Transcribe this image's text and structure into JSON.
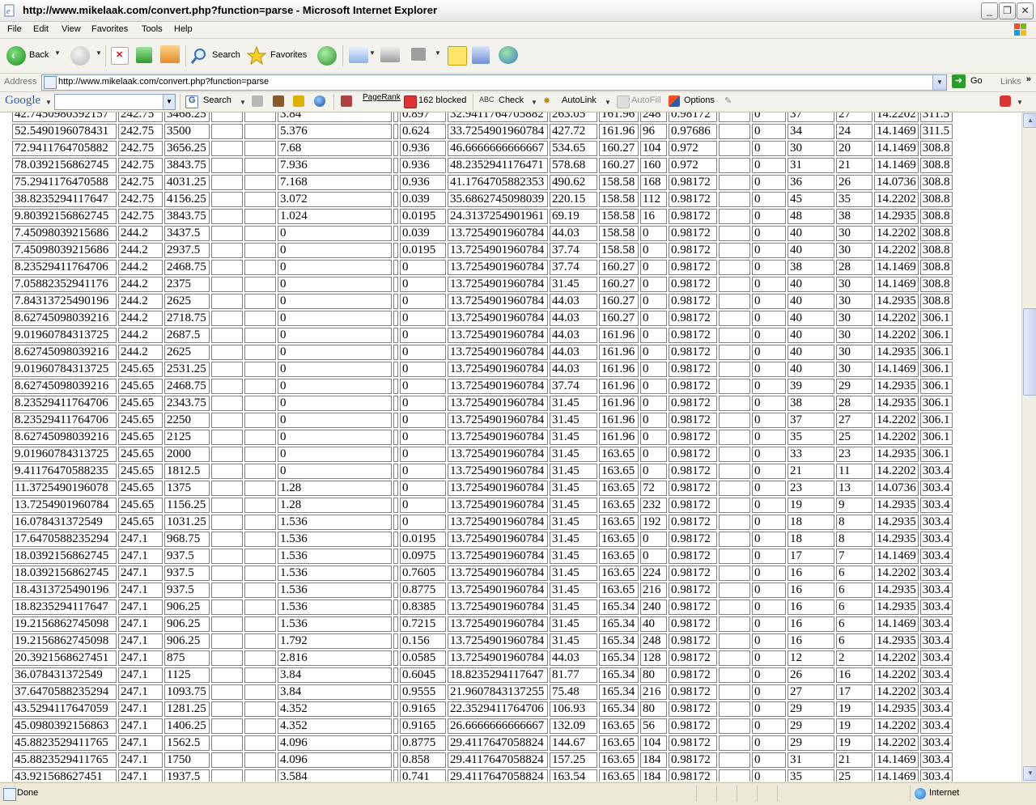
{
  "window": {
    "title": "http://www.mikelaak.com/convert.php?function=parse - Microsoft Internet Explorer"
  },
  "menu": [
    "File",
    "Edit",
    "View",
    "Favorites",
    "Tools",
    "Help"
  ],
  "toolbar": {
    "back": "Back",
    "search": "Search",
    "favorites": "Favorites"
  },
  "address": {
    "label": "Address",
    "url": "http://www.mikelaak.com/convert.php?function=parse",
    "go": "Go",
    "links": "Links"
  },
  "google": {
    "logo": "Google",
    "search": "Search",
    "pagerank": "PageRank",
    "blocked": "162 blocked",
    "check": "Check",
    "autolink": "AutoLink",
    "autofill": "AutoFill",
    "options": "Options"
  },
  "status": {
    "text": "Done",
    "zone": "Internet"
  },
  "table": {
    "rows": [
      [
        "42.7450980392157",
        "242.75",
        "3468.25",
        "",
        "",
        "3.84",
        "",
        "0.897",
        "32.9411764705882",
        "263.05",
        "161.96",
        "248",
        "0.98172",
        "",
        "0",
        "37",
        "27",
        "14.2202",
        "311.5"
      ],
      [
        "52.5490196078431",
        "242.75",
        "3500",
        "",
        "",
        "5.376",
        "",
        "0.624",
        "33.7254901960784",
        "427.72",
        "161.96",
        "96",
        "0.97686",
        "",
        "0",
        "34",
        "24",
        "14.1469",
        "311.5"
      ],
      [
        "72.9411764705882",
        "242.75",
        "3656.25",
        "",
        "",
        "7.68",
        "",
        "0.936",
        "46.6666666666667",
        "534.65",
        "160.27",
        "104",
        "0.972",
        "",
        "0",
        "30",
        "20",
        "14.1469",
        "308.8"
      ],
      [
        "78.0392156862745",
        "242.75",
        "3843.75",
        "",
        "",
        "7.936",
        "",
        "0.936",
        "48.2352941176471",
        "578.68",
        "160.27",
        "160",
        "0.972",
        "",
        "0",
        "31",
        "21",
        "14.1469",
        "308.8"
      ],
      [
        "75.2941176470588",
        "242.75",
        "4031.25",
        "",
        "",
        "7.168",
        "",
        "0.936",
        "41.1764705882353",
        "490.62",
        "158.58",
        "168",
        "0.98172",
        "",
        "0",
        "36",
        "26",
        "14.0736",
        "308.8"
      ],
      [
        "38.8235294117647",
        "242.75",
        "4156.25",
        "",
        "",
        "3.072",
        "",
        "0.039",
        "35.6862745098039",
        "220.15",
        "158.58",
        "112",
        "0.98172",
        "",
        "0",
        "45",
        "35",
        "14.2202",
        "308.8"
      ],
      [
        "9.80392156862745",
        "242.75",
        "3843.75",
        "",
        "",
        "1.024",
        "",
        "0.0195",
        "24.3137254901961",
        "69.19",
        "158.58",
        "16",
        "0.98172",
        "",
        "0",
        "48",
        "38",
        "14.2935",
        "308.8"
      ],
      [
        "7.45098039215686",
        "244.2",
        "3437.5",
        "",
        "",
        "0",
        "",
        "0.039",
        "13.7254901960784",
        "44.03",
        "158.58",
        "0",
        "0.98172",
        "",
        "0",
        "40",
        "30",
        "14.2202",
        "308.8"
      ],
      [
        "7.45098039215686",
        "244.2",
        "2937.5",
        "",
        "",
        "0",
        "",
        "0.0195",
        "13.7254901960784",
        "37.74",
        "158.58",
        "0",
        "0.98172",
        "",
        "0",
        "40",
        "30",
        "14.2202",
        "308.8"
      ],
      [
        "8.23529411764706",
        "244.2",
        "2468.75",
        "",
        "",
        "0",
        "",
        "0",
        "13.7254901960784",
        "37.74",
        "160.27",
        "0",
        "0.98172",
        "",
        "0",
        "38",
        "28",
        "14.1469",
        "308.8"
      ],
      [
        "7.05882352941176",
        "244.2",
        "2375",
        "",
        "",
        "0",
        "",
        "0",
        "13.7254901960784",
        "31.45",
        "160.27",
        "0",
        "0.98172",
        "",
        "0",
        "40",
        "30",
        "14.1469",
        "308.8"
      ],
      [
        "7.84313725490196",
        "244.2",
        "2625",
        "",
        "",
        "0",
        "",
        "0",
        "13.7254901960784",
        "44.03",
        "160.27",
        "0",
        "0.98172",
        "",
        "0",
        "40",
        "30",
        "14.2935",
        "308.8"
      ],
      [
        "8.62745098039216",
        "244.2",
        "2718.75",
        "",
        "",
        "0",
        "",
        "0",
        "13.7254901960784",
        "44.03",
        "160.27",
        "0",
        "0.98172",
        "",
        "0",
        "40",
        "30",
        "14.2202",
        "306.1"
      ],
      [
        "9.01960784313725",
        "244.2",
        "2687.5",
        "",
        "",
        "0",
        "",
        "0",
        "13.7254901960784",
        "44.03",
        "161.96",
        "0",
        "0.98172",
        "",
        "0",
        "40",
        "30",
        "14.2202",
        "306.1"
      ],
      [
        "8.62745098039216",
        "244.2",
        "2625",
        "",
        "",
        "0",
        "",
        "0",
        "13.7254901960784",
        "44.03",
        "161.96",
        "0",
        "0.98172",
        "",
        "0",
        "40",
        "30",
        "14.2935",
        "306.1"
      ],
      [
        "9.01960784313725",
        "245.65",
        "2531.25",
        "",
        "",
        "0",
        "",
        "0",
        "13.7254901960784",
        "44.03",
        "161.96",
        "0",
        "0.98172",
        "",
        "0",
        "40",
        "30",
        "14.1469",
        "306.1"
      ],
      [
        "8.62745098039216",
        "245.65",
        "2468.75",
        "",
        "",
        "0",
        "",
        "0",
        "13.7254901960784",
        "37.74",
        "161.96",
        "0",
        "0.98172",
        "",
        "0",
        "39",
        "29",
        "14.2935",
        "306.1"
      ],
      [
        "8.23529411764706",
        "245.65",
        "2343.75",
        "",
        "",
        "0",
        "",
        "0",
        "13.7254901960784",
        "31.45",
        "161.96",
        "0",
        "0.98172",
        "",
        "0",
        "38",
        "28",
        "14.2935",
        "306.1"
      ],
      [
        "8.23529411764706",
        "245.65",
        "2250",
        "",
        "",
        "0",
        "",
        "0",
        "13.7254901960784",
        "31.45",
        "161.96",
        "0",
        "0.98172",
        "",
        "0",
        "37",
        "27",
        "14.2202",
        "306.1"
      ],
      [
        "8.62745098039216",
        "245.65",
        "2125",
        "",
        "",
        "0",
        "",
        "0",
        "13.7254901960784",
        "31.45",
        "161.96",
        "0",
        "0.98172",
        "",
        "0",
        "35",
        "25",
        "14.2202",
        "306.1"
      ],
      [
        "9.01960784313725",
        "245.65",
        "2000",
        "",
        "",
        "0",
        "",
        "0",
        "13.7254901960784",
        "31.45",
        "163.65",
        "0",
        "0.98172",
        "",
        "0",
        "33",
        "23",
        "14.2935",
        "306.1"
      ],
      [
        "9.41176470588235",
        "245.65",
        "1812.5",
        "",
        "",
        "0",
        "",
        "0",
        "13.7254901960784",
        "31.45",
        "163.65",
        "0",
        "0.98172",
        "",
        "0",
        "21",
        "11",
        "14.2202",
        "303.4"
      ],
      [
        "11.3725490196078",
        "245.65",
        "1375",
        "",
        "",
        "1.28",
        "",
        "0",
        "13.7254901960784",
        "31.45",
        "163.65",
        "72",
        "0.98172",
        "",
        "0",
        "23",
        "13",
        "14.0736",
        "303.4"
      ],
      [
        "13.7254901960784",
        "245.65",
        "1156.25",
        "",
        "",
        "1.28",
        "",
        "0",
        "13.7254901960784",
        "31.45",
        "163.65",
        "232",
        "0.98172",
        "",
        "0",
        "19",
        "9",
        "14.2935",
        "303.4"
      ],
      [
        "16.078431372549",
        "245.65",
        "1031.25",
        "",
        "",
        "1.536",
        "",
        "0",
        "13.7254901960784",
        "31.45",
        "163.65",
        "192",
        "0.98172",
        "",
        "0",
        "18",
        "8",
        "14.2935",
        "303.4"
      ],
      [
        "17.6470588235294",
        "247.1",
        "968.75",
        "",
        "",
        "1.536",
        "",
        "0.0195",
        "13.7254901960784",
        "31.45",
        "163.65",
        "0",
        "0.98172",
        "",
        "0",
        "18",
        "8",
        "14.2935",
        "303.4"
      ],
      [
        "18.0392156862745",
        "247.1",
        "937.5",
        "",
        "",
        "1.536",
        "",
        "0.0975",
        "13.7254901960784",
        "31.45",
        "163.65",
        "0",
        "0.98172",
        "",
        "0",
        "17",
        "7",
        "14.1469",
        "303.4"
      ],
      [
        "18.0392156862745",
        "247.1",
        "937.5",
        "",
        "",
        "1.536",
        "",
        "0.7605",
        "13.7254901960784",
        "31.45",
        "163.65",
        "224",
        "0.98172",
        "",
        "0",
        "16",
        "6",
        "14.2202",
        "303.4"
      ],
      [
        "18.4313725490196",
        "247.1",
        "937.5",
        "",
        "",
        "1.536",
        "",
        "0.8775",
        "13.7254901960784",
        "31.45",
        "163.65",
        "216",
        "0.98172",
        "",
        "0",
        "16",
        "6",
        "14.2935",
        "303.4"
      ],
      [
        "18.8235294117647",
        "247.1",
        "906.25",
        "",
        "",
        "1.536",
        "",
        "0.8385",
        "13.7254901960784",
        "31.45",
        "165.34",
        "240",
        "0.98172",
        "",
        "0",
        "16",
        "6",
        "14.2935",
        "303.4"
      ],
      [
        "19.2156862745098",
        "247.1",
        "906.25",
        "",
        "",
        "1.536",
        "",
        "0.7215",
        "13.7254901960784",
        "31.45",
        "165.34",
        "40",
        "0.98172",
        "",
        "0",
        "16",
        "6",
        "14.1469",
        "303.4"
      ],
      [
        "19.2156862745098",
        "247.1",
        "906.25",
        "",
        "",
        "1.792",
        "",
        "0.156",
        "13.7254901960784",
        "31.45",
        "165.34",
        "248",
        "0.98172",
        "",
        "0",
        "16",
        "6",
        "14.2935",
        "303.4"
      ],
      [
        "20.3921568627451",
        "247.1",
        "875",
        "",
        "",
        "2.816",
        "",
        "0.0585",
        "13.7254901960784",
        "44.03",
        "165.34",
        "128",
        "0.98172",
        "",
        "0",
        "12",
        "2",
        "14.2202",
        "303.4"
      ],
      [
        "36.078431372549",
        "247.1",
        "1125",
        "",
        "",
        "3.84",
        "",
        "0.6045",
        "18.8235294117647",
        "81.77",
        "165.34",
        "80",
        "0.98172",
        "",
        "0",
        "26",
        "16",
        "14.2202",
        "303.4"
      ],
      [
        "37.6470588235294",
        "247.1",
        "1093.75",
        "",
        "",
        "3.84",
        "",
        "0.9555",
        "21.9607843137255",
        "75.48",
        "165.34",
        "216",
        "0.98172",
        "",
        "0",
        "27",
        "17",
        "14.2202",
        "303.4"
      ],
      [
        "43.5294117647059",
        "247.1",
        "1281.25",
        "",
        "",
        "4.352",
        "",
        "0.9165",
        "22.3529411764706",
        "106.93",
        "165.34",
        "80",
        "0.98172",
        "",
        "0",
        "29",
        "19",
        "14.2935",
        "303.4"
      ],
      [
        "45.0980392156863",
        "247.1",
        "1406.25",
        "",
        "",
        "4.352",
        "",
        "0.9165",
        "26.6666666666667",
        "132.09",
        "163.65",
        "56",
        "0.98172",
        "",
        "0",
        "29",
        "19",
        "14.2202",
        "303.4"
      ],
      [
        "45.8823529411765",
        "247.1",
        "1562.5",
        "",
        "",
        "4.096",
        "",
        "0.8775",
        "29.4117647058824",
        "144.67",
        "163.65",
        "104",
        "0.98172",
        "",
        "0",
        "29",
        "19",
        "14.2202",
        "303.4"
      ],
      [
        "45.8823529411765",
        "247.1",
        "1750",
        "",
        "",
        "4.096",
        "",
        "0.858",
        "29.4117647058824",
        "157.25",
        "163.65",
        "184",
        "0.98172",
        "",
        "0",
        "31",
        "21",
        "14.1469",
        "303.4"
      ],
      [
        "43.921568627451",
        "247.1",
        "1937.5",
        "",
        "",
        "3.584",
        "",
        "0.741",
        "29.4117647058824",
        "163.54",
        "163.65",
        "184",
        "0.98172",
        "",
        "0",
        "35",
        "25",
        "14.1469",
        "303.4"
      ]
    ]
  }
}
